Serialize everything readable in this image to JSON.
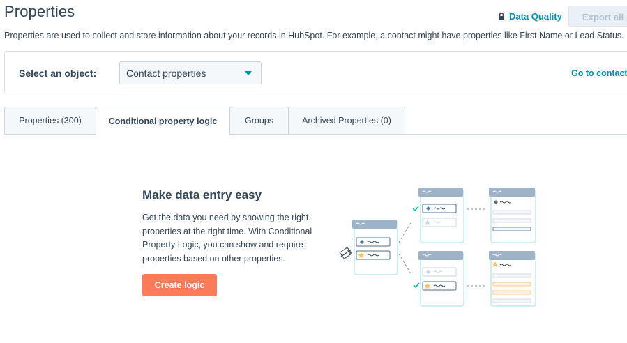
{
  "header": {
    "title": "Properties",
    "data_quality_label": "Data Quality",
    "export_label": "Export all p",
    "description": "Properties are used to collect and store information about your records in HubSpot. For example, a contact might have properties like First Name or Lead Status."
  },
  "object_selector": {
    "label": "Select an object:",
    "selected": "Contact properties",
    "go_to_link": "Go to contacts"
  },
  "tabs": [
    {
      "label": "Properties (300)",
      "active": false
    },
    {
      "label": "Conditional property logic",
      "active": true
    },
    {
      "label": "Groups",
      "active": false
    },
    {
      "label": "Archived Properties (0)",
      "active": false
    }
  ],
  "empty_state": {
    "heading": "Make data entry easy",
    "body": "Get the data you need by showing the right properties at the right time. With Conditional Property Logic, you can show and require properties based on other properties.",
    "cta_label": "Create logic"
  },
  "colors": {
    "brand_teal": "#0091ae",
    "cta_orange": "#ff7a59",
    "text_primary": "#33475b",
    "border": "#cbd6e2"
  }
}
